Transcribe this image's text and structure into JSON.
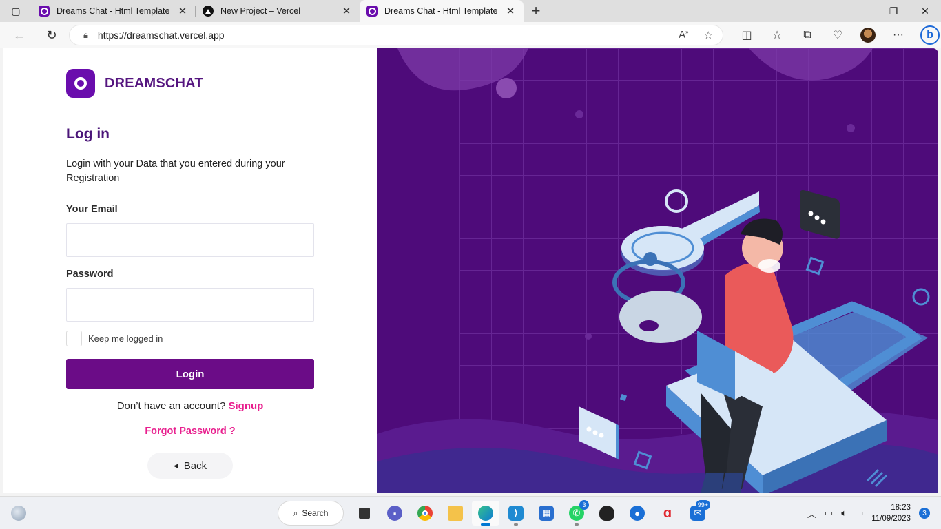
{
  "browser": {
    "tabs": [
      {
        "title": "Dreams Chat - Html Template",
        "favicon": "dreamschat-icon",
        "active": false
      },
      {
        "title": "New Project – Vercel",
        "favicon": "vercel-icon",
        "active": false
      },
      {
        "title": "Dreams Chat - Html Template",
        "favicon": "dreamschat-icon",
        "active": true
      }
    ],
    "url": "https://dreamschat.vercel.app"
  },
  "brand": {
    "name": "DREAMSCHAT",
    "color": "#6a0dad"
  },
  "login": {
    "title": "Log in",
    "description": "Login with your Data that you entered during your Registration",
    "email_label": "Your Email",
    "email_value": "",
    "password_label": "Password",
    "password_value": "",
    "remember_label": "Keep me logged in",
    "remember_checked": false,
    "submit_label": "Login",
    "no_account_text": "Don’t have an account?",
    "signup_label": "Signup",
    "forgot_label": "Forgot Password ?",
    "back_label": "Back"
  },
  "colors": {
    "accent_pink": "#e81f8e",
    "button_purple": "#6b0c87",
    "hero_bg": "#4e0b7a"
  },
  "taskbar": {
    "search_label": "Search",
    "apps": [
      {
        "name": "windows-start-icon"
      },
      {
        "name": "search"
      },
      {
        "name": "task-view-icon"
      },
      {
        "name": "teams-chat-icon"
      },
      {
        "name": "chrome-icon"
      },
      {
        "name": "file-explorer-icon"
      },
      {
        "name": "edge-icon",
        "active": true
      },
      {
        "name": "vscode-icon"
      },
      {
        "name": "ms-store-icon"
      },
      {
        "name": "whatsapp-icon",
        "badge": "3"
      },
      {
        "name": "linux-penguin-icon"
      },
      {
        "name": "maps-icon"
      },
      {
        "name": "airtel-icon"
      },
      {
        "name": "mail-icon",
        "badge": "99+"
      }
    ],
    "time": "18:23",
    "date": "11/09/2023",
    "notifications": "3"
  }
}
